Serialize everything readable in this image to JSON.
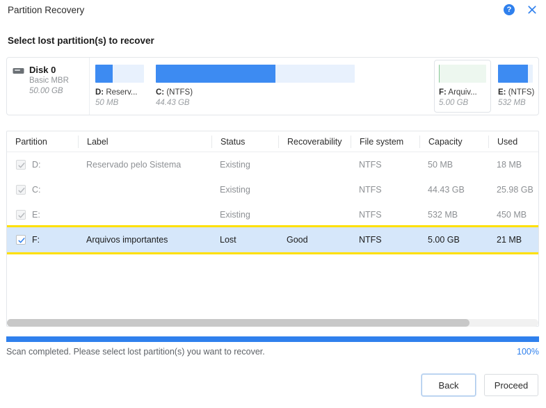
{
  "window": {
    "title": "Partition Recovery",
    "help_icon": "help-circle-icon",
    "help_glyph": "?",
    "close_icon": "close-icon"
  },
  "heading": "Select lost partition(s) to recover",
  "disk": {
    "icon": "hard-disk-icon",
    "name": "Disk 0",
    "type": "Basic MBR",
    "size": "50.00 GB",
    "partitions": [
      {
        "letter": "D:",
        "label": "Reserv...",
        "size": "50 MB",
        "fs": "",
        "used_pct": 36,
        "fill_color": "#3d8bf2",
        "track_color": "#e8f1fd",
        "selected": false
      },
      {
        "letter": "C:",
        "label": "(NTFS)",
        "size": "44.43 GB",
        "fs": "",
        "used_pct": 60,
        "fill_color": "#3d8bf2",
        "track_color": "#e8f1fd",
        "selected": false
      },
      {
        "letter": "F:",
        "label": "Arquiv...",
        "size": "5.00 GB",
        "fs": "",
        "used_pct": 2,
        "fill_color": "#86c695",
        "track_color": "#edf7ef",
        "selected": true
      },
      {
        "letter": "E:",
        "label": "(NTFS)",
        "size": "532 MB",
        "fs": "",
        "used_pct": 85,
        "fill_color": "#3d8bf2",
        "track_color": "#e8f1fd",
        "selected": false
      }
    ]
  },
  "table": {
    "columns": [
      "Partition",
      "Label",
      "Status",
      "Recoverability",
      "File system",
      "Capacity",
      "Used"
    ],
    "rows": [
      {
        "checked": true,
        "enabled": false,
        "partition": "D:",
        "label": "Reservado pelo Sistema",
        "status": "Existing",
        "status_state": "existing",
        "recoverability": "",
        "filesystem": "NTFS",
        "capacity": "50 MB",
        "used": "18 MB",
        "highlighted": false
      },
      {
        "checked": true,
        "enabled": false,
        "partition": "C:",
        "label": "",
        "status": "Existing",
        "status_state": "existing",
        "recoverability": "",
        "filesystem": "NTFS",
        "capacity": "44.43 GB",
        "used": "25.98 GB",
        "highlighted": false
      },
      {
        "checked": true,
        "enabled": false,
        "partition": "E:",
        "label": "",
        "status": "Existing",
        "status_state": "existing",
        "recoverability": "",
        "filesystem": "NTFS",
        "capacity": "532 MB",
        "used": "450 MB",
        "highlighted": false
      },
      {
        "checked": true,
        "enabled": true,
        "partition": "F:",
        "label": "Arquivos importantes",
        "status": "Lost",
        "status_state": "lost",
        "recoverability": "Good",
        "filesystem": "NTFS",
        "capacity": "5.00 GB",
        "used": "21 MB",
        "highlighted": true
      }
    ]
  },
  "scrollbar": {
    "thumb_pct": 87
  },
  "progress": {
    "message": "Scan completed. Please select lost partition(s) you want to recover.",
    "percent_label": "100%",
    "percent": 100,
    "bar_color": "#2f80ed"
  },
  "footer": {
    "back_label": "Back",
    "proceed_label": "Proceed"
  }
}
